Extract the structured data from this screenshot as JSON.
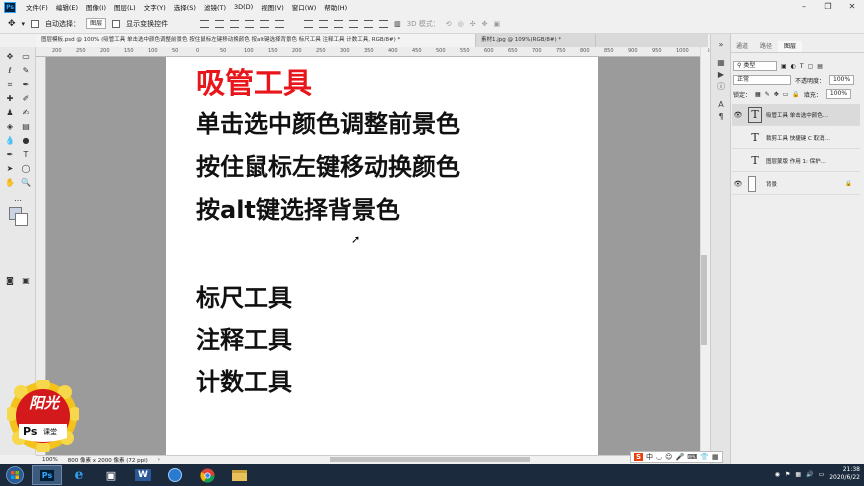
{
  "menu": [
    "文件(F)",
    "编辑(E)",
    "图像(I)",
    "图层(L)",
    "文字(Y)",
    "选择(S)",
    "滤镜(T)",
    "3D(D)",
    "视图(V)",
    "窗口(W)",
    "帮助(H)"
  ],
  "app_logo": "Ps",
  "window_controls": [
    "–",
    "❐",
    "✕"
  ],
  "options": {
    "auto_select_label": "自动选择：",
    "auto_select_value": "图层",
    "show_transform_label": "显示变换控件",
    "mode_3d": "3D 模式："
  },
  "tabs": [
    "图层模板.psd @ 100% (吸管工具 单击选中颜色调整前景色 按住鼠标左键移动换颜色 按alt键选择背景色  标尺工具 注释工具 计数工具, RGB/8#) *",
    "素材1.jpg @ 109%(RGB/8#) *"
  ],
  "ruler_marks": [
    "200",
    "250",
    "200",
    "150",
    "100",
    "50",
    "0",
    "50",
    "100",
    "150",
    "200",
    "250",
    "300",
    "350",
    "400",
    "450",
    "500",
    "550",
    "600",
    "650",
    "700",
    "750",
    "800",
    "850",
    "900",
    "950",
    "1000",
    "1050"
  ],
  "canvas": {
    "title": "吸管工具",
    "lines": [
      "单击选中颜色调整前景色",
      "按住鼠标左键移动换颜色",
      "按alt键选择背景色",
      "标尺工具",
      "注释工具",
      "计数工具"
    ]
  },
  "status": {
    "zoom": "100%",
    "doc_size": "800 像素 x 2000 像素 (72 ppi)"
  },
  "panel": {
    "tabs": [
      "通道",
      "路径",
      "图层"
    ],
    "filter_label": "类型",
    "blend_mode": "正常",
    "opacity_label": "不透明度：",
    "opacity_value": "100%",
    "lock_label": "锁定：",
    "fill_label": "填充：",
    "fill_value": "100%",
    "layers": [
      {
        "thumb": "T",
        "name": "吸管工具 单击选中颜色..."
      },
      {
        "thumb": "T",
        "name": "裁剪工具 快捷键 C 取消..."
      },
      {
        "thumb": "T",
        "name": "图层蒙版 作用  1: 保护..."
      },
      {
        "thumb": "",
        "name": "背景"
      }
    ]
  },
  "watermark": {
    "line1": "阳光",
    "brand": "Ps",
    "course": "课堂"
  },
  "taskbar": {
    "time": "21:38",
    "date": "2020/6/22",
    "ime": "中"
  },
  "colors": {
    "title_red": "#e8161a",
    "workspace_gray": "#9b9b9b",
    "taskbar": "#1b2b3d"
  }
}
